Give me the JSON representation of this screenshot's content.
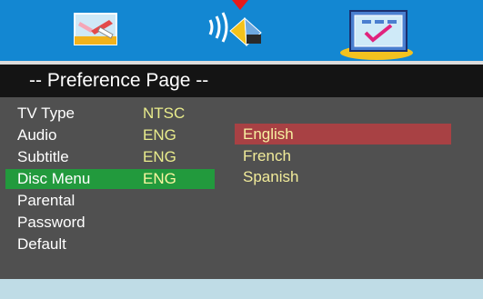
{
  "topbar": {
    "icons": [
      "picture-settings-icon",
      "audio-speaker-icon",
      "preference-checklist-icon"
    ],
    "active_index": 2
  },
  "title": "-- Preference Page --",
  "menu": {
    "items": [
      {
        "label": "TV Type",
        "value": "NTSC"
      },
      {
        "label": "Audio",
        "value": "ENG"
      },
      {
        "label": "Subtitle",
        "value": "ENG"
      },
      {
        "label": "Disc Menu",
        "value": "ENG"
      },
      {
        "label": "Parental",
        "value": ""
      },
      {
        "label": "Password",
        "value": ""
      },
      {
        "label": "Default",
        "value": ""
      }
    ],
    "selected_index": 3
  },
  "options": {
    "items": [
      "English",
      "French",
      "Spanish"
    ],
    "highlighted_index": 0
  },
  "colors": {
    "topbar": "#1387d2",
    "title_bg": "#141414",
    "body_bg": "#505050",
    "selected_row": "#229a3d",
    "highlighted_option": "#a84144",
    "value_text": "#e9ec8c",
    "footer": "#bfdce6",
    "cursor_arrow": "#e81a1a"
  }
}
